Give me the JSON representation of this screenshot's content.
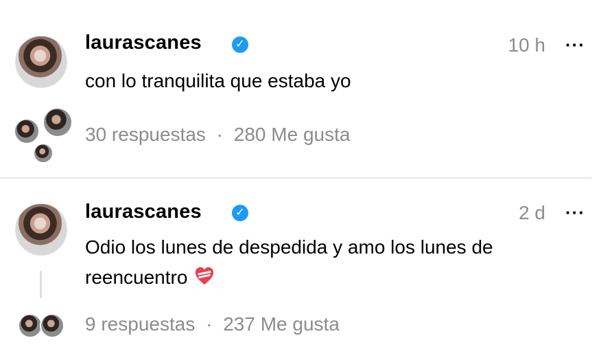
{
  "posts": [
    {
      "username": "laurascanes",
      "time": "10 h",
      "more": "···",
      "text": "con lo tranquilita que estaba yo",
      "replies": "30  respuestas",
      "sep": "·",
      "likes": "280 Me gusta"
    },
    {
      "username": "laurascanes",
      "time": "2 d",
      "more": "···",
      "text_line1": "Odio los lunes de despedida y amo los lunes de",
      "text_line2": "reencuentro",
      "replies": "9  respuestas",
      "sep": "·",
      "likes": "237 Me gusta"
    }
  ],
  "colors": {
    "verified": "#1d9bf0",
    "muted": "#8c8c8c",
    "heart": "#e8424f"
  },
  "icons": {
    "verified": "verified-badge-icon",
    "more": "more-options-icon",
    "heart": "mending-heart-icon"
  }
}
